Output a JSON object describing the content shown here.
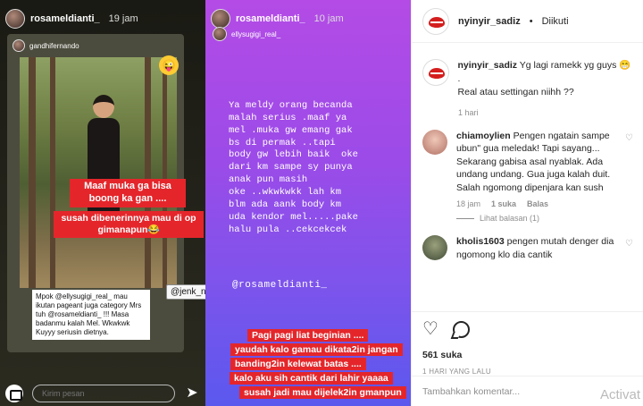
{
  "story_a": {
    "user": "rosameldianti_",
    "time": "19 jam",
    "repost_user": "gandhifernando",
    "red_line_1": "Maaf muka ga bisa boong ka gan ....",
    "red_line_2": "susah dibenerinnya mau di op gimanapun😂",
    "note": "Mpok @ellysugigi_real_ mau ikutan pageant juga category Mrs tuh @rosameldianti_ !!! Masa badanmu kalah Mel. Wkwkwk Kuyyy seriusin dietnya.",
    "tag": "@jenk_nyinyir",
    "message_placeholder": "Kirim pesan"
  },
  "story_b": {
    "user": "rosameldianti_",
    "time": "10 jam",
    "repost_user": "ellysugigi_real_",
    "text_lines": [
      "Ya meldy orang becanda",
      "malah serius .maaf ya",
      "mel .muka gw emang gak",
      "bs di permak ..tapi",
      "body gw lebih baik  oke",
      "dari km sampe sy punya",
      "anak pun masih",
      "oke ..wkwkwkk lah km",
      "blm ada aank body km",
      "uda kendor mel.....pake",
      "halu pula ..cekcekcek"
    ],
    "tag": "@rosameldianti_",
    "red_lines": [
      "Pagi pagi liat beginian ....",
      "yaudah kalo gamau dikata2in jangan",
      "banding2in kelewat batas ....",
      "kalo aku sih cantik dari lahir yaaaa",
      "susah jadi mau dijelek2in gmanpun"
    ]
  },
  "post": {
    "username": "nyinyir_sadiz",
    "separator": "•",
    "follow_status": "Diikuti",
    "caption_user": "nyinyir_sadiz",
    "caption_line_1": "Yg lagi ramekk yg guys 😁",
    "caption_line_2": ".",
    "caption_line_3": "Real atau settingan niihh ??",
    "caption_age": "1 hari",
    "comments": [
      {
        "user": "chiamoylien",
        "text": "Pengen ngatain sampe ubun\" gua meledak! Tapi sayang... Sekarang gabisa asal nyablak. Ada undang undang. Gua juga kalah duit. Salah ngomong dipenjara kan sush",
        "age": "18 jam",
        "likes": "1 suka",
        "reply": "Balas",
        "view_replies": "Lihat balasan (1)"
      },
      {
        "user": "kholis1603",
        "text": "pengen mutah denger dia ngomong klo dia cantik"
      }
    ],
    "likes": "561 suka",
    "date": "1 HARI YANG LALU",
    "comment_placeholder": "Tambahkan komentar...",
    "watermark": "Activat"
  },
  "icons": {
    "heart": "♡",
    "send": "➤"
  }
}
